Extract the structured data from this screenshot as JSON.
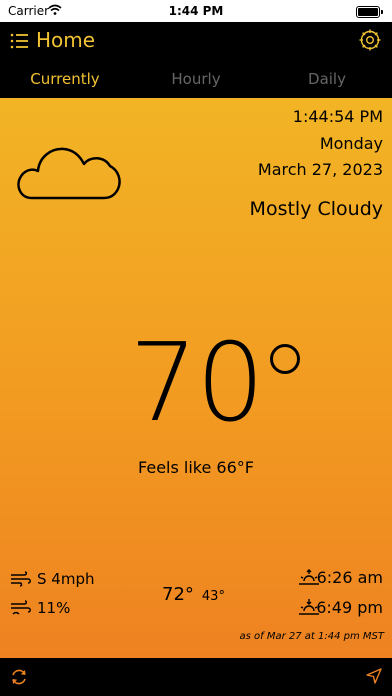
{
  "status_bar": {
    "carrier": "Carrier",
    "time": "1:44 PM"
  },
  "nav": {
    "title": "Home"
  },
  "tabs": [
    {
      "label": "Currently",
      "active": true
    },
    {
      "label": "Hourly",
      "active": false
    },
    {
      "label": "Daily",
      "active": false
    }
  ],
  "current": {
    "time": "1:44:54 PM",
    "day": "Monday",
    "date": "March 27, 2023",
    "condition": "Mostly Cloudy",
    "temperature": "70",
    "feels_like": "Feels like 66°F",
    "wind": "S 4mph",
    "humidity": "11%",
    "high": "72°",
    "low": "43°",
    "sunrise": "6:26 am",
    "sunset": "6:49 pm",
    "updated": "as of Mar 27 at 1:44 pm MST"
  },
  "colors": {
    "accent": "#f1c232",
    "gradient_top": "#f2b425",
    "gradient_bottom": "#ee8221"
  },
  "icons": [
    "wifi-icon",
    "battery-icon",
    "menu-icon",
    "gear-icon",
    "cloud-icon",
    "wind-icon",
    "humidity-icon",
    "sunrise-icon",
    "sunset-icon",
    "refresh-icon",
    "location-arrow-icon"
  ]
}
